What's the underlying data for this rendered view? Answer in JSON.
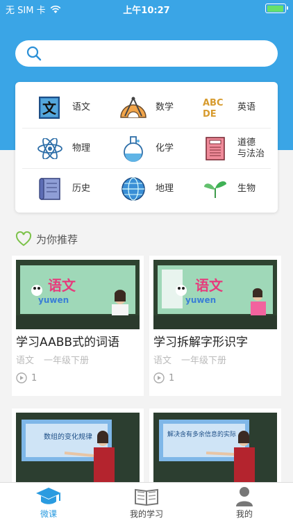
{
  "status_bar": {
    "carrier": "无 SIM 卡",
    "time": "上午10:27",
    "battery_level": 0.95
  },
  "search": {
    "placeholder": ""
  },
  "subjects": [
    {
      "label": "语文",
      "icon": "chinese-book-icon"
    },
    {
      "label": "数学",
      "icon": "protractor-icon"
    },
    {
      "label": "英语",
      "icon": "abc-letters-icon"
    },
    {
      "label": "物理",
      "icon": "atom-icon"
    },
    {
      "label": "化学",
      "icon": "flask-icon"
    },
    {
      "label": "道德\n与法治",
      "icon": "law-book-icon"
    },
    {
      "label": "历史",
      "icon": "scroll-icon"
    },
    {
      "label": "地理",
      "icon": "globe-icon"
    },
    {
      "label": "生物",
      "icon": "sprout-icon"
    }
  ],
  "recommend": {
    "title": "为你推荐",
    "icon": "heart-outline-icon"
  },
  "courses": [
    {
      "title": "学习AABB式的词语",
      "subject": "语文",
      "grade": "一年级下册",
      "views": "1",
      "thumb_banner": "语文",
      "thumb_sub": "yuwen"
    },
    {
      "title": "学习拆解字形识字",
      "subject": "语文",
      "grade": "一年级下册",
      "views": "1",
      "thumb_banner": "语文",
      "thumb_sub": "yuwen"
    },
    {
      "title": "",
      "subject": "",
      "grade": "",
      "views": "",
      "thumb_banner": "数组的变化规律"
    },
    {
      "title": "",
      "subject": "",
      "grade": "",
      "views": "",
      "thumb_banner": "解决含有多余信息的实际"
    }
  ],
  "tabs": [
    {
      "label": "微课",
      "icon": "graduation-cap-icon",
      "active": true
    },
    {
      "label": "我的学习",
      "icon": "open-book-icon",
      "active": false
    },
    {
      "label": "我的",
      "icon": "user-icon",
      "active": false
    }
  ],
  "colors": {
    "primary": "#3aa5e6",
    "active_tab": "#2a9be0",
    "heart": "#7cc24a"
  }
}
